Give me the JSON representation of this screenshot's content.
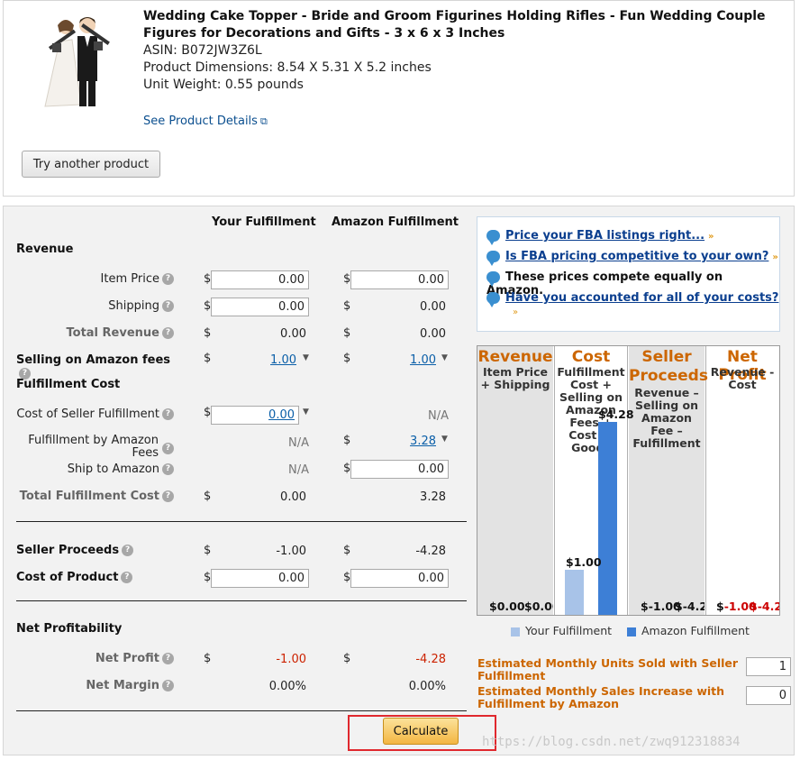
{
  "product": {
    "title": "Wedding Cake Topper - Bride and Groom Figurines Holding Rifles - Fun Wedding Couple Figures for Decorations and Gifts - 3 x 6 x 3 Inches",
    "asin": "ASIN: B072JW3Z6L",
    "dimensions": "Product Dimensions: 8.54 X 5.31 X 5.2 inches",
    "weight": "Unit Weight: 0.55 pounds",
    "details_link": "See Product Details",
    "details_link_icon": "external-link-icon",
    "try_button": "Try another product"
  },
  "columns": {
    "your": "Your Fulfillment",
    "amazon": "Amazon Fulfillment"
  },
  "currency": "$",
  "sections": {
    "revenue": "Revenue",
    "fulfillment_cost": "Fulfillment Cost",
    "net_profitability": "Net Profitability"
  },
  "rows": {
    "item_price": {
      "label": "Item Price",
      "your": "0.00",
      "amazon": "0.00"
    },
    "shipping": {
      "label": "Shipping",
      "your": "0.00",
      "amazon": "0.00"
    },
    "total_revenue": {
      "label": "Total Revenue",
      "your": "0.00",
      "amazon": "0.00"
    },
    "selling_fees": {
      "label": "Selling on Amazon fees",
      "your": "1.00",
      "amazon": "1.00"
    },
    "cost_seller_fulfillment": {
      "label": "Cost of Seller Fulfillment",
      "your": "0.00",
      "amazon": "N/A"
    },
    "fba_fees": {
      "label": "Fulfillment by Amazon Fees",
      "your": "N/A",
      "amazon": "3.28"
    },
    "ship_to_amazon": {
      "label": "Ship to Amazon",
      "your": "N/A",
      "amazon": "0.00"
    },
    "total_fulfillment": {
      "label": "Total Fulfillment Cost",
      "your": "0.00",
      "amazon": "3.28"
    },
    "seller_proceeds": {
      "label": "Seller Proceeds",
      "your": "-1.00",
      "amazon": "-4.28"
    },
    "cost_of_product": {
      "label": "Cost of Product",
      "your": "0.00",
      "amazon": "0.00"
    },
    "net_profit": {
      "label": "Net Profit",
      "your": "-1.00",
      "amazon": "-4.28"
    },
    "net_margin": {
      "label": "Net Margin",
      "your": "0.00%",
      "amazon": "0.00%"
    }
  },
  "tips": [
    {
      "text": "Price your FBA listings right...",
      "link": true
    },
    {
      "text": "Is FBA pricing competitive to your own?",
      "link": true
    },
    {
      "text": "These prices compete equally on Amazon.",
      "link": false
    },
    {
      "text": "Have you accounted for all of your costs?",
      "link": true
    }
  ],
  "chart": {
    "panels": [
      {
        "head": "Revenue",
        "sub": "Item Price + Shipping"
      },
      {
        "head": "Cost",
        "sub": "Fulfillment Cost + Selling on Amazon Fees + Cost of Goods"
      },
      {
        "head": "Seller Proceeds",
        "sub": "Revenue – Selling on Amazon Fee – Fulfillment"
      },
      {
        "head": "Net Profit",
        "sub": "Revenue - Cost"
      }
    ],
    "labels": {
      "rev_your": "$0.00",
      "rev_amz": "$0.00",
      "cost_your": "$1.00",
      "cost_amz": "$4.28",
      "sp_your": "$-1.00",
      "sp_amz": "$-4.2",
      "np_your": "$-1.00",
      "np_amz": "$-4.2"
    },
    "legend_your": "Your Fulfillment",
    "legend_amazon": "Amazon Fulfillment",
    "colors": {
      "your": "#a8c3e8",
      "amazon": "#3d7fd6",
      "heading": "#cc6600"
    }
  },
  "chart_data": {
    "type": "bar",
    "categories": [
      "Revenue",
      "Cost",
      "Seller Proceeds",
      "Net Profit"
    ],
    "series": [
      {
        "name": "Your Fulfillment",
        "values": [
          0.0,
          1.0,
          -1.0,
          -1.0
        ]
      },
      {
        "name": "Amazon Fulfillment",
        "values": [
          0.0,
          4.28,
          -4.28,
          -4.28
        ]
      }
    ]
  },
  "estimates": {
    "seller_units_label": "Estimated Monthly Units Sold with Seller Fulfillment",
    "seller_units_value": "1",
    "amazon_increase_label": "Estimated Monthly Sales Increase with Fulfillment by Amazon",
    "amazon_increase_value": "0"
  },
  "calculate_button": "Calculate",
  "watermark": "https://blog.csdn.net/zwq912318834"
}
